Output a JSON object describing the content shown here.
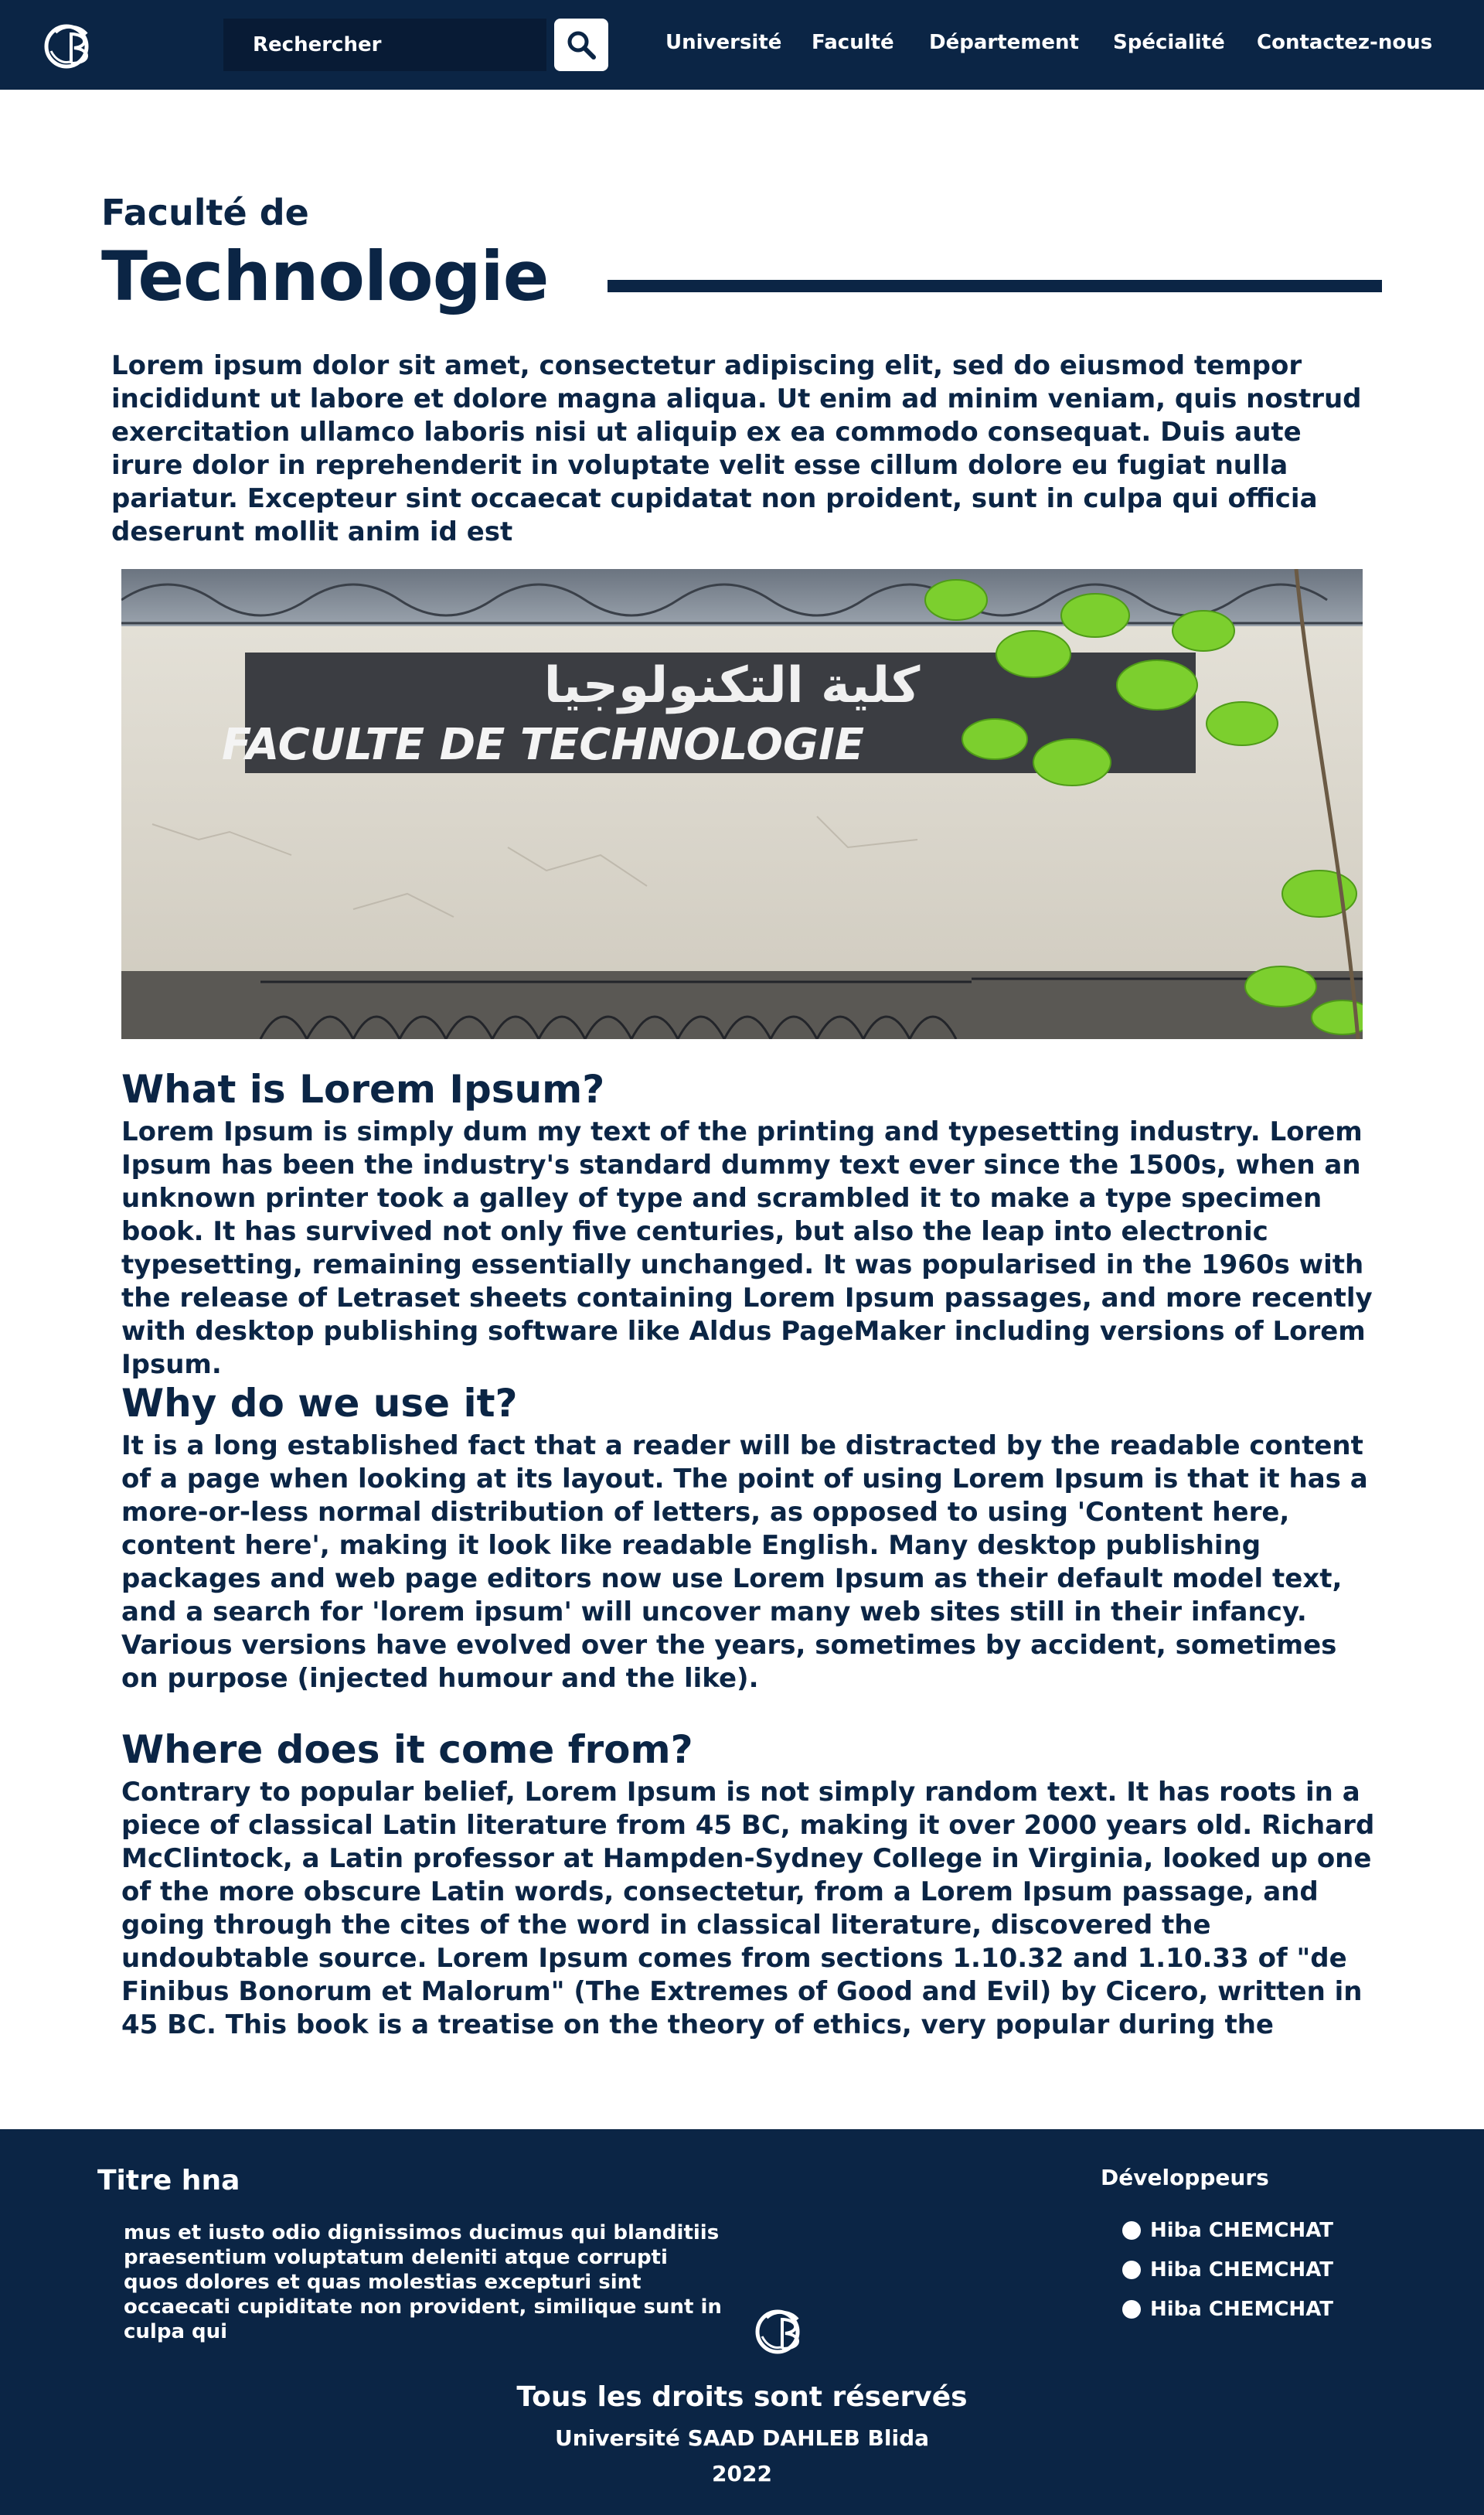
{
  "header": {
    "search": {
      "placeholder": "Rechercher"
    },
    "nav": [
      "Université",
      "Faculté",
      "Département",
      "Spécialité",
      "Contactez-nous"
    ]
  },
  "hero": {
    "subtitle": "Faculté de",
    "title": "Technologie",
    "intro": "Lorem ipsum dolor sit amet, consectetur adipiscing elit, sed do eiusmod tempor incididunt ut labore et dolore magna aliqua. Ut enim ad minim veniam, quis nostrud exercitation ullamco laboris nisi ut aliquip ex ea commodo consequat. Duis aute irure dolor in reprehenderit in voluptate velit esse cillum dolore eu fugiat nulla pariatur. Excepteur sint occaecat cupidatat non proident, sunt in culpa qui officia deserunt mollit anim id est"
  },
  "photo": {
    "sign_arabic": "كلية التكنولوجيا",
    "sign_latin": "FACULTE   DE   TECHNOLOGIE"
  },
  "sections": [
    {
      "heading": "What is Lorem Ipsum?",
      "body": "Lorem Ipsum is simply dum my text of the printing and typesetting industry. Lorem Ipsum has been the industry's standard dummy text ever since the 1500s, when an unknown printer took a galley of type and scrambled it to make a type specimen book. It has survived not only five centuries, but also the leap into electronic typesetting, remaining essentially unchanged. It was popularised in the 1960s with the release of Letraset sheets containing Lorem Ipsum passages, and more recently with desktop publishing software like Aldus PageMaker including versions of Lorem Ipsum."
    },
    {
      "heading": "Why do we use it?",
      "body": "It is a long established fact that a reader will be distracted by the readable content of a page when looking at its layout. The point of using Lorem Ipsum is that it has a more-or-less normal distribution of letters, as opposed to using 'Content here, content here', making it look like readable English. Many desktop publishing packages and web page editors now use Lorem Ipsum as their default model text, and a search for 'lorem ipsum' will uncover many web sites still in their infancy. Various versions have evolved over the years, sometimes by accident, sometimes on purpose (injected humour and the like)."
    },
    {
      "heading": "Where does it come from?",
      "body": "Contrary to popular belief, Lorem Ipsum is not simply random text. It has roots in a piece of classical Latin literature from 45 BC, making it over 2000 years old. Richard McClintock, a Latin professor at Hampden-Sydney College in Virginia, looked up one of the more obscure Latin words, consectetur, from a Lorem Ipsum passage, and going through the cites of the word in classical literature, discovered the undoubtable source. Lorem Ipsum comes from sections 1.10.32 and 1.10.33 of \"de Finibus Bonorum et Malorum\" (The Extremes of Good and Evil) by Cicero, written in 45 BC. This book is a treatise on the theory of ethics, very popular during the Renaissance. The first line of Lorem Ipsum, \"Lorem"
    }
  ],
  "footer": {
    "title": "Titre hna",
    "text": "mus et iusto odio dignissimos ducimus qui blanditiis praesentium voluptatum deleniti atque corrupti quos dolores et quas molestias excepturi sint occaecati cupiditate non provident, similique sunt in culpa qui",
    "developers_label": "Développeurs",
    "developers": [
      "Hiba CHEMCHAT",
      "Hiba CHEMCHAT",
      "Hiba CHEMCHAT"
    ],
    "rights": "Tous les droits sont réservés",
    "university": "Université SAAD DAHLEB Blida",
    "year": "2022"
  },
  "colors": {
    "navy": "#0b2545",
    "white": "#ffffff"
  },
  "icons": [
    "university-logo-icon",
    "search-icon",
    "bullet-icon"
  ]
}
